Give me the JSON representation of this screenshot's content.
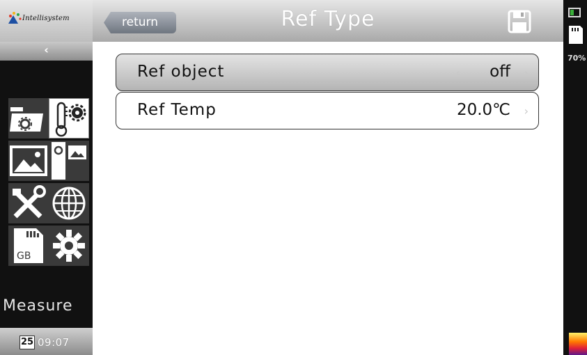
{
  "sidebar": {
    "logo_text": "Intellisystem",
    "collapse_glyph": "‹",
    "tiles": [
      {
        "name": "folder-settings-icon",
        "active": false
      },
      {
        "name": "thermometer-settings-icon",
        "active": true
      },
      {
        "name": "image-icon",
        "active": false
      },
      {
        "name": "camera-image-icon",
        "active": false
      },
      {
        "name": "tools-icon",
        "active": false
      },
      {
        "name": "globe-icon",
        "active": false
      },
      {
        "name": "sd-card-icon",
        "active": false
      },
      {
        "name": "gear-icon",
        "active": false
      }
    ],
    "sd_tile_label": "GB",
    "mode_label": "Measure",
    "clock_day": "25",
    "clock_time": "09:07"
  },
  "header": {
    "return_label": "return",
    "title": "Ref Type",
    "save_icon": "floppy-disk-icon"
  },
  "status": {
    "storage_percent": "70%",
    "battery_color": "#3ab03a"
  },
  "settings": {
    "ref_object": {
      "label": "Ref object",
      "value": "off"
    },
    "ref_temp": {
      "label": "Ref Temp",
      "value": "20.0℃"
    }
  },
  "colors": {
    "sidebar_bg": "#111111",
    "tile_bg": "#3a3a3a",
    "active_tile_bg": "#ffffff",
    "return_button": "#8c939c"
  }
}
